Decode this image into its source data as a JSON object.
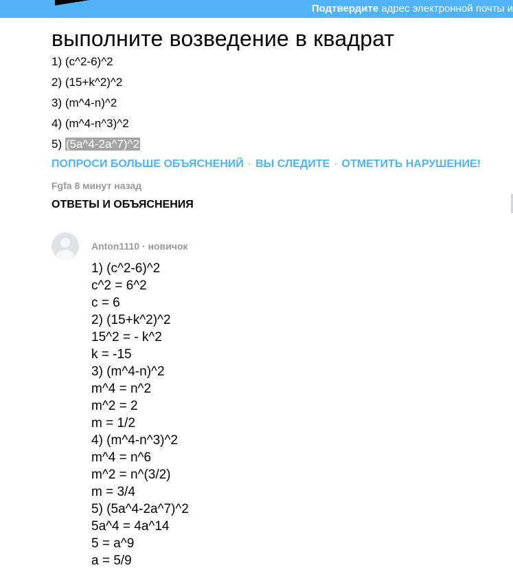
{
  "header": {
    "confirm_bold": "Подтвердите",
    "confirm_rest": "адрес электронной почты и"
  },
  "question": {
    "title": "выполните возведение в квадрат",
    "items": [
      "1) (c^2-6)^2",
      "2) (15+k^2)^2",
      "3) (m^4-n)^2",
      "4) (m^4-n^3)^2"
    ],
    "item5_prefix": "5)",
    "item5_selected": "(5a^4-2a^7)^2"
  },
  "actions": {
    "ask_more": "ПОПРОСИ БОЛЬШЕ ОБЪЯСНЕНИЙ",
    "following": "ВЫ СЛЕДИТЕ",
    "report": "ОТМЕТИТЬ НАРУШЕНИЕ!",
    "separator": "·"
  },
  "meta": {
    "asker": "Fgfa",
    "time": "8 минут назад"
  },
  "answers_heading": "ОТВЕТЫ И ОБЪЯСНЕНИЯ",
  "answer": {
    "author": "Anton1110",
    "rank": "· новичок",
    "lines": [
      "1) (c^2-6)^2",
      "c^2 = 6^2",
      "c = 6",
      "2) (15+k^2)^2",
      "15^2 = - k^2",
      "k = -15",
      "3) (m^4-n)^2",
      "m^4 = n^2",
      "m^2 = 2",
      "m = 1/2",
      "4) (m^4-n^3)^2",
      "m^4 = n^6",
      "m^2 = n^(3/2)",
      "m = 3/4",
      "5) (5a^4-2a^7)^2",
      "5a^4 = 4a^14",
      "5 = a^9",
      "a = 5/9"
    ]
  },
  "colors": {
    "brand_blue": "#4fb3f6",
    "muted_gray": "#999999",
    "selection_gray": "#a5a5a5"
  }
}
